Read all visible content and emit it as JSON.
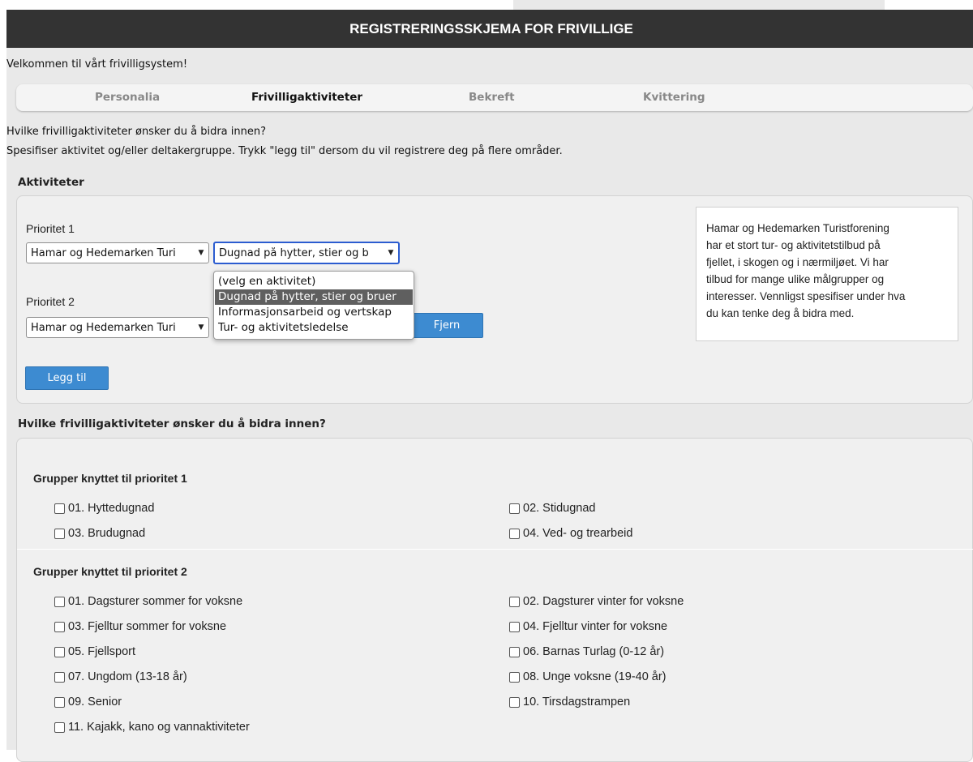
{
  "header": {
    "title": "REGISTRERINGSSKJEMA FOR FRIVILLIGE"
  },
  "welcome": "Velkommen til vårt frivilligsystem!",
  "steps": [
    "Personalia",
    "Frivilligaktiviteter",
    "Bekreft",
    "Kvittering"
  ],
  "active_step": "Frivilligaktiviteter",
  "intro": {
    "line1": "Hvilke frivilligaktiviteter ønsker du å bidra innen?",
    "line2": "Spesifiser aktivitet og/eller deltakergruppe. Trykk \"legg til\" dersom du vil registrere deg på flere områder."
  },
  "activities": {
    "heading": "Aktiviteter",
    "priority1": {
      "label": "Prioritet 1",
      "organization": "Hamar og Hedemarken Turi",
      "activity": "Dugnad på hytter, stier og b"
    },
    "priority2": {
      "label": "Prioritet 2",
      "organization": "Hamar og Hedemarken Turi",
      "remove_label": "Fjern"
    },
    "dropdown_options": [
      "(velg en aktivitet)",
      "Dugnad på hytter, stier og bruer",
      "Informasjonsarbeid og vertskap",
      "Tur- og aktivitetsledelse"
    ],
    "dropdown_selected_index": 1,
    "add_label": "Legg til",
    "info_lines": [
      "Hamar og Hedemarken Turistforening",
      "har et stort tur- og aktivitetstilbud på",
      "fjellet, i skogen og i nærmiljøet. Vi har",
      "tilbud for mange ulike målgrupper og",
      "interesser. Vennligst spesifiser under hva",
      "du kan tenke deg å bidra med."
    ]
  },
  "groups": {
    "heading": "Hvilke frivilligaktiviteter ønsker du å bidra innen?",
    "group1": {
      "title": "Grupper knyttet til prioritet 1",
      "items": [
        "01. Hyttedugnad",
        "02. Stidugnad",
        "03. Brudugnad",
        "04. Ved- og trearbeid"
      ]
    },
    "group2": {
      "title": "Grupper knyttet til prioritet 2",
      "items": [
        "01. Dagsturer sommer for voksne",
        "02. Dagsturer vinter for voksne",
        "03. Fjelltur sommer for voksne",
        "04. Fjelltur vinter for voksne",
        "05. Fjellsport",
        "06. Barnas Turlag (0-12 år)",
        "07. Ungdom (13-18 år)",
        "08. Unge voksne (19-40 år)",
        "09. Senior",
        "10. Tirsdagstrampen",
        "11. Kajakk, kano og vannaktiviteter"
      ]
    }
  }
}
